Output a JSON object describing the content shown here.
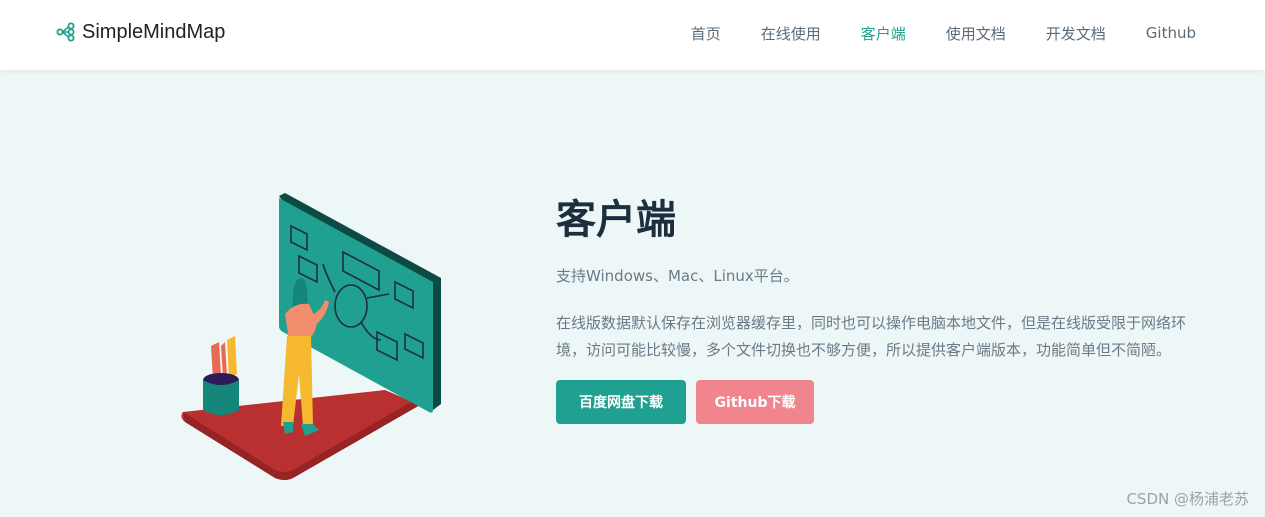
{
  "header": {
    "brand_name": "SimpleMindMap",
    "nav": [
      {
        "label": "首页",
        "active": false
      },
      {
        "label": "在线使用",
        "active": false
      },
      {
        "label": "客户端",
        "active": true
      },
      {
        "label": "使用文档",
        "active": false
      },
      {
        "label": "开发文档",
        "active": false
      },
      {
        "label": "Github",
        "active": false
      }
    ]
  },
  "main": {
    "title": "客户端",
    "subtitle": "支持Windows、Mac、Linux平台。",
    "description": "在线版数据默认保存在浏览器缓存里，同时也可以操作电脑本地文件，但是在线版受限于网络环境，访问可能比较慢，多个文件切换也不够方便，所以提供客户端版本，功能简单但不简陋。",
    "buttons": {
      "baidu": "百度网盘下载",
      "github": "Github下载"
    }
  },
  "watermark": "CSDN @杨浦老苏",
  "colors": {
    "accent": "#1fa090",
    "secondary": "#f0858d",
    "background": "#eef7f7"
  }
}
